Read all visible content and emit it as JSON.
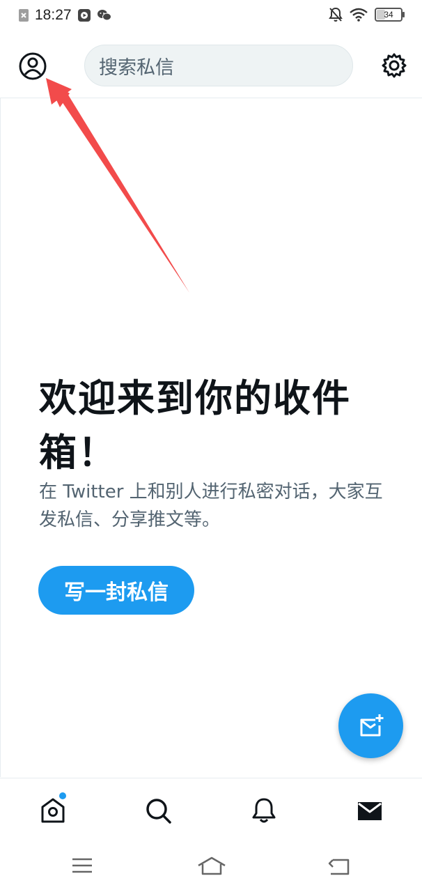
{
  "status_bar": {
    "time": "18:27",
    "battery_level": "34"
  },
  "header": {
    "search_placeholder": "搜索私信",
    "profile_icon": "user-circle-icon",
    "settings_icon": "gear-icon"
  },
  "main": {
    "title": "欢迎来到你的收件箱！",
    "description": "在 Twitter 上和别人进行私密对话，大家互发私信、分享推文等。",
    "write_button_label": "写一封私信"
  },
  "fab": {
    "icon": "new-message-icon"
  },
  "tabs": [
    {
      "name": "home",
      "icon": "home-icon",
      "badge": true
    },
    {
      "name": "search",
      "icon": "search-icon"
    },
    {
      "name": "notifications",
      "icon": "bell-icon"
    },
    {
      "name": "messages",
      "icon": "envelope-icon",
      "active": true
    }
  ],
  "colors": {
    "accent": "#1d9bf0",
    "annotation": "#f24b4b",
    "text_primary": "#0f1419",
    "text_secondary": "#536471"
  }
}
